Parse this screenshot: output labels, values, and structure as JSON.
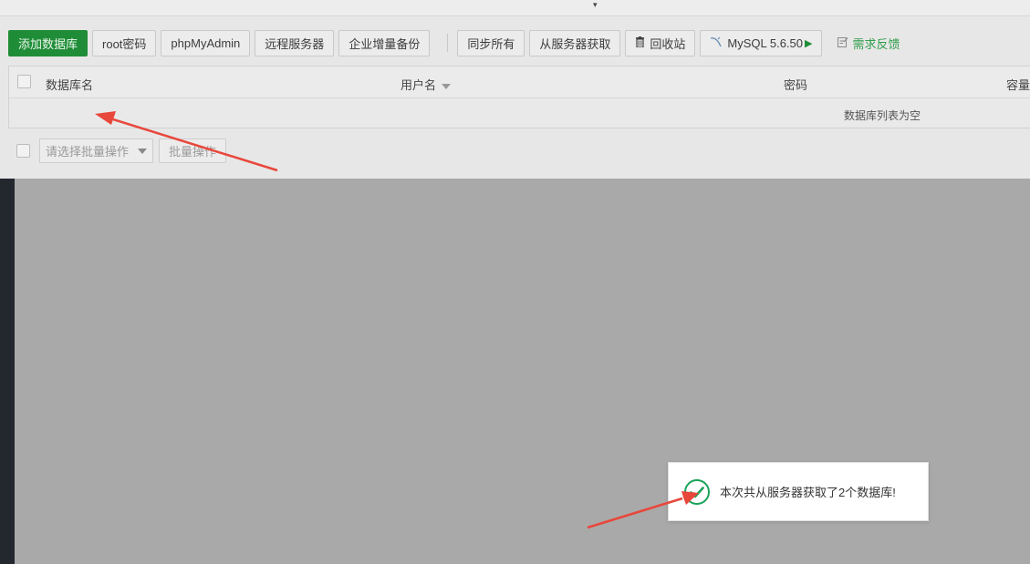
{
  "toolbar": {
    "add_db": "添加数据库",
    "root_pwd": "root密码",
    "phpmyadmin": "phpMyAdmin",
    "remote_server": "远程服务器",
    "incremental_backup": "企业增量备份",
    "sync_all": "同步所有",
    "fetch_from_server": "从服务器获取",
    "recycle_bin": "回收站",
    "mysql_version": "MySQL 5.6.50",
    "feedback": "需求反馈"
  },
  "table": {
    "col_name": "数据库名",
    "col_user": "用户名",
    "col_password": "密码",
    "col_capacity": "容量",
    "empty_text": "数据库列表为空"
  },
  "batch": {
    "select_placeholder": "请选择批量操作",
    "apply": "批量操作"
  },
  "toast": {
    "message": "本次共从服务器获取了2个数据库!"
  },
  "colors": {
    "accent_green": "#1f8d37",
    "annotation_red": "#e8473b"
  },
  "icons": {
    "recycle": "trash-icon",
    "mysql": "dolphin-icon",
    "feedback": "edit-icon",
    "toast": "check-circle-icon"
  }
}
